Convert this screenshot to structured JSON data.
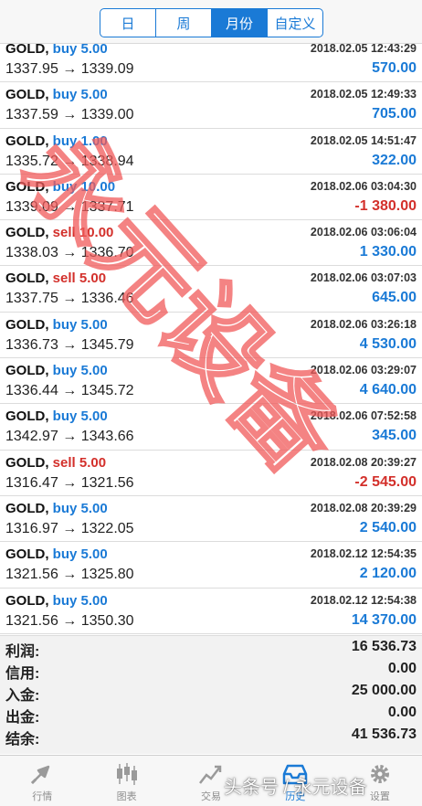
{
  "segments": [
    {
      "label": "日",
      "active": false
    },
    {
      "label": "周",
      "active": false
    },
    {
      "label": "月份",
      "active": true
    },
    {
      "label": "自定义",
      "active": false
    }
  ],
  "trades": [
    {
      "symbol": "GOLD,",
      "side": "buy",
      "volume": "buy 5.00",
      "date": "2018.02.05 12:43:29",
      "prices": "1337.95 → 1339.09",
      "profit": "570.00"
    },
    {
      "symbol": "GOLD,",
      "side": "buy",
      "volume": "buy 5.00",
      "date": "2018.02.05 12:49:33",
      "prices": "1337.59 → 1339.00",
      "profit": "705.00"
    },
    {
      "symbol": "GOLD,",
      "side": "buy",
      "volume": "buy 1.00",
      "date": "2018.02.05 14:51:47",
      "prices": "1335.72 → 1338.94",
      "profit": "322.00"
    },
    {
      "symbol": "GOLD,",
      "side": "buy",
      "volume": "buy 10.00",
      "date": "2018.02.06 03:04:30",
      "prices": "1339.09 → 1337.71",
      "profit": "-1 380.00"
    },
    {
      "symbol": "GOLD,",
      "side": "sell",
      "volume": "sell 10.00",
      "date": "2018.02.06 03:06:04",
      "prices": "1338.03 → 1336.70",
      "profit": "1 330.00"
    },
    {
      "symbol": "GOLD,",
      "side": "sell",
      "volume": "sell 5.00",
      "date": "2018.02.06 03:07:03",
      "prices": "1337.75 → 1336.46",
      "profit": "645.00"
    },
    {
      "symbol": "GOLD,",
      "side": "buy",
      "volume": "buy 5.00",
      "date": "2018.02.06 03:26:18",
      "prices": "1336.73 → 1345.79",
      "profit": "4 530.00"
    },
    {
      "symbol": "GOLD,",
      "side": "buy",
      "volume": "buy 5.00",
      "date": "2018.02.06 03:29:07",
      "prices": "1336.44 → 1345.72",
      "profit": "4 640.00"
    },
    {
      "symbol": "GOLD,",
      "side": "buy",
      "volume": "buy 5.00",
      "date": "2018.02.06 07:52:58",
      "prices": "1342.97 → 1343.66",
      "profit": "345.00"
    },
    {
      "symbol": "GOLD,",
      "side": "sell",
      "volume": "sell 5.00",
      "date": "2018.02.08 20:39:27",
      "prices": "1316.47 → 1321.56",
      "profit": "-2 545.00"
    },
    {
      "symbol": "GOLD,",
      "side": "buy",
      "volume": "buy 5.00",
      "date": "2018.02.08 20:39:29",
      "prices": "1316.97 → 1322.05",
      "profit": "2 540.00"
    },
    {
      "symbol": "GOLD,",
      "side": "buy",
      "volume": "buy 5.00",
      "date": "2018.02.12 12:54:35",
      "prices": "1321.56 → 1325.80",
      "profit": "2 120.00"
    },
    {
      "symbol": "GOLD,",
      "side": "buy",
      "volume": "buy 5.00",
      "date": "2018.02.12 12:54:38",
      "prices": "1321.56 → 1350.30",
      "profit": "14 370.00"
    }
  ],
  "summary": {
    "profit_label": "利润:",
    "profit_value": "16 536.73",
    "credit_label": "信用:",
    "credit_value": "0.00",
    "deposit_label": "入金:",
    "deposit_value": "25 000.00",
    "withdrawal_label": "出金:",
    "withdrawal_value": "0.00",
    "balance_label": "结余:",
    "balance_value": "41 536.73"
  },
  "tabs": [
    {
      "label": "行情",
      "icon": "quotes-icon",
      "active": false
    },
    {
      "label": "图表",
      "icon": "chart-icon",
      "active": false
    },
    {
      "label": "交易",
      "icon": "trade-icon",
      "active": false
    },
    {
      "label": "历史",
      "icon": "history-icon",
      "active": true
    },
    {
      "label": "设置",
      "icon": "gear-icon",
      "active": false
    }
  ],
  "watermark_diagonal": "永元设备",
  "watermark_footer": "头条号 / 永元设备",
  "colors": {
    "accent": "#1a7ad6",
    "buy": "#1a7ad6",
    "sell": "#d3302b",
    "negative": "#d3302b",
    "watermark": "#f05a5a"
  }
}
